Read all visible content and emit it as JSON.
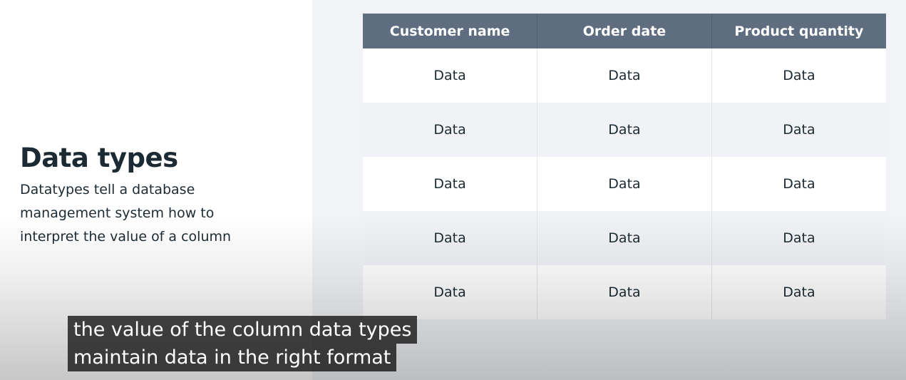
{
  "slide": {
    "title": "Data types",
    "description": "Datatypes tell a database management system how to interpret the value of a column"
  },
  "table": {
    "headers": [
      "Customer name",
      "Order date",
      "Product quantity"
    ],
    "rows": [
      [
        "Data",
        "Data",
        "Data"
      ],
      [
        "Data",
        "Data",
        "Data"
      ],
      [
        "Data",
        "Data",
        "Data"
      ],
      [
        "Data",
        "Data",
        "Data"
      ],
      [
        "Data",
        "Data",
        "Data"
      ]
    ],
    "header_color": "#5e6e80"
  },
  "captions": {
    "line1": "the value of the column data types",
    "line2": "maintain data in the right format"
  }
}
